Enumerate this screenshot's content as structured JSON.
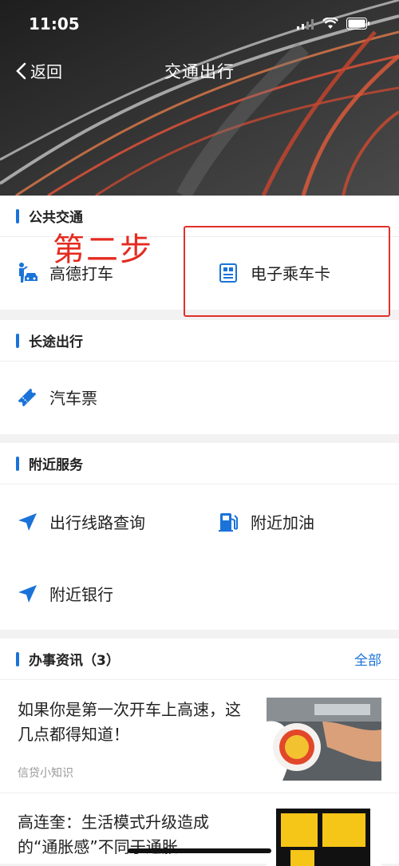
{
  "status_bar": {
    "time": "11:05"
  },
  "nav": {
    "back_label": "返回",
    "title": "交通出行"
  },
  "sections": {
    "public_transport": {
      "title": "公共交通",
      "items": [
        {
          "label": "高德打车",
          "icon": "taxi-person-icon"
        },
        {
          "label": "电子乘车卡",
          "icon": "transit-card-icon"
        }
      ]
    },
    "long_distance": {
      "title": "长途出行",
      "items": [
        {
          "label": "汽车票",
          "icon": "ticket-icon"
        }
      ]
    },
    "nearby": {
      "title": "附近服务",
      "items": [
        {
          "label": "出行线路查询",
          "icon": "navigation-arrow-icon"
        },
        {
          "label": "附近加油",
          "icon": "gas-station-icon"
        },
        {
          "label": "附近银行",
          "icon": "navigation-arrow-icon"
        }
      ]
    },
    "news": {
      "title": "办事资讯（3）",
      "more_label": "全部",
      "articles": [
        {
          "title": "如果你是第一次开车上高速，这几点都得知道！",
          "source": "信贷小知识"
        },
        {
          "title": "高连奎：生活模式升级造成的“通胀感”不同于通胀",
          "source": ""
        }
      ]
    }
  },
  "annotation": {
    "text": "第二步",
    "color": "#e52b20"
  },
  "colors": {
    "accent": "#1a73d9"
  }
}
